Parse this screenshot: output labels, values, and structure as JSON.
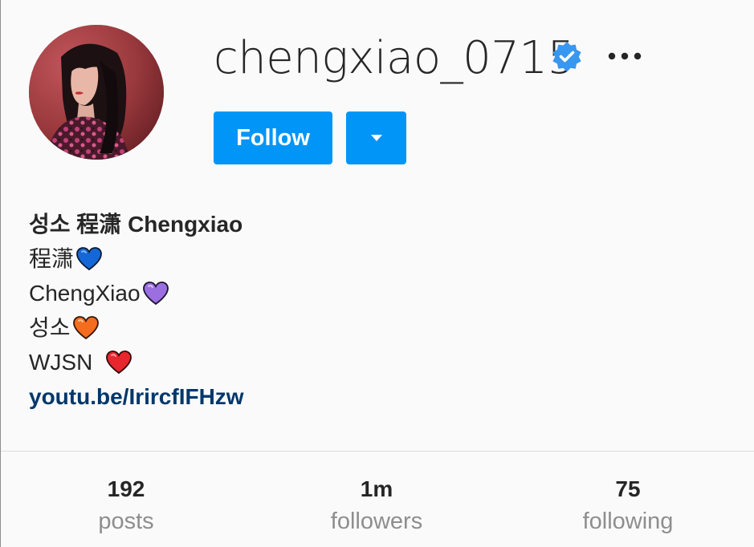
{
  "profile": {
    "username": "chengxiao_0715",
    "verified": true,
    "avatar_icon": "profile-photo"
  },
  "actions": {
    "follow_label": "Follow",
    "dropdown_icon": "caret-down-icon",
    "more_icon": "ellipsis-icon"
  },
  "bio": {
    "name": "성소 程潇 Chengxiao",
    "lines": [
      {
        "text": "程潇",
        "heart": "blue-heart",
        "color": "#1467d6"
      },
      {
        "text": "ChengXiao",
        "heart": "purple-heart",
        "color": "#9b6fe0"
      },
      {
        "text": "성소",
        "heart": "orange-heart",
        "color": "#f46d1e"
      },
      {
        "text": "WJSN ",
        "heart": "red-heart",
        "color": "#e8262e"
      }
    ],
    "link": "youtu.be/IrircfIFHzw"
  },
  "stats": {
    "posts": {
      "count": "192",
      "label": "posts"
    },
    "followers": {
      "count": "1m",
      "label": "followers"
    },
    "following": {
      "count": "75",
      "label": "following"
    }
  },
  "colors": {
    "accent": "#0095f6",
    "verified_badge": "#3897f0",
    "link": "#00376b",
    "muted": "#8e8e8e",
    "background": "#fafafa"
  }
}
